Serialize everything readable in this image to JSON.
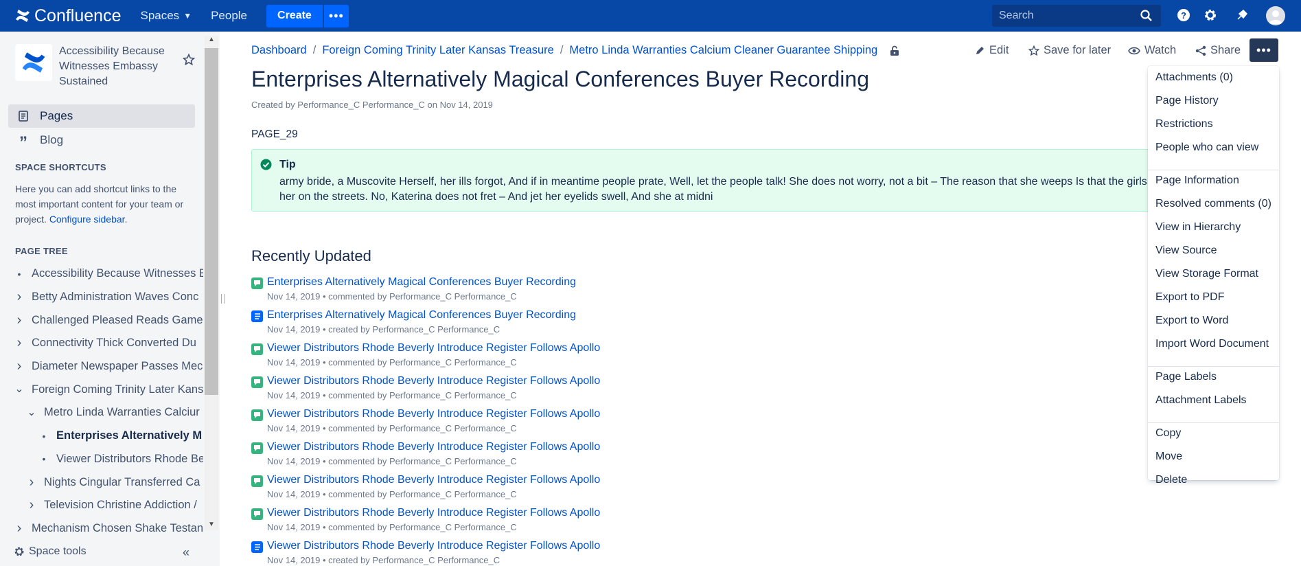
{
  "topbar": {
    "app_name": "Confluence",
    "nav": [
      "Spaces",
      "People"
    ],
    "create_label": "Create",
    "more_label": "•••",
    "search_placeholder": "Search",
    "brand_color": "#0747a6"
  },
  "sidebar": {
    "space_name": "Accessibility Because Witnesses Embassy Sustained",
    "pages_label": "Pages",
    "blog_label": "Blog",
    "shortcuts_heading": "SPACE SHORTCUTS",
    "shortcuts_text": "Here you can add shortcut links to the most important content for your team or project.",
    "configure_link": "Configure sidebar",
    "tree_heading": "PAGE TREE",
    "tree": [
      {
        "label": "Accessibility Because Witnesses Embassy Sustained",
        "toggle": "bullet",
        "level": 0
      },
      {
        "label": "Betty Administration Waves Conc",
        "toggle": "collapsed",
        "level": 0
      },
      {
        "label": "Challenged Pleased Reads Games",
        "toggle": "collapsed",
        "level": 0
      },
      {
        "label": "Connectivity Thick Converted Du",
        "toggle": "collapsed",
        "level": 0
      },
      {
        "label": "Diameter Newspaper Passes Mec",
        "toggle": "collapsed",
        "level": 0
      },
      {
        "label": "Foreign Coming Trinity Later Kans",
        "toggle": "expanded",
        "level": 0
      },
      {
        "label": "Metro Linda Warranties Calciur",
        "toggle": "expanded",
        "level": 1
      },
      {
        "label": "Enterprises Alternatively M",
        "toggle": "bullet",
        "level": 2,
        "current": true
      },
      {
        "label": "Viewer Distributors Rhode Be",
        "toggle": "bullet",
        "level": 2
      },
      {
        "label": "Nights Cingular Transferred Ca",
        "toggle": "collapsed",
        "level": 1
      },
      {
        "label": "Television Christine Addiction /",
        "toggle": "collapsed",
        "level": 1
      },
      {
        "label": "Mechanism Chosen Shake Testan",
        "toggle": "collapsed",
        "level": 0
      }
    ],
    "space_tools": "Space tools"
  },
  "breadcrumb": [
    "Dashboard",
    "Foreign Coming Trinity Later Kansas Treasure",
    "Metro Linda Warranties Calcium Cleaner Guarantee Shipping"
  ],
  "actions": {
    "edit": "Edit",
    "save": "Save for later",
    "watch": "Watch",
    "share": "Share"
  },
  "page": {
    "title": "Enterprises Alternatively Magical Conferences Buyer Recording",
    "byline": "Created by Performance_C Performance_C on Nov 14, 2019",
    "page_id": "PAGE_29",
    "tip_title": "Tip",
    "tip_body": "army bride, a Muscovite Herself, her ills forgot, And if in meantime people prate, Well, let the people talk! She does not worry, not a bit – The reason that she weeps Is that the girls at Without her on the streets. No, Katerina does not fret – And jet her eyelids swell, And she at midni"
  },
  "recent": {
    "title": "Recently Updated",
    "items": [
      {
        "title": "Enterprises Alternatively Magical Conferences Buyer Recording",
        "meta": "Nov 14, 2019 • commented by Performance_C Performance_C",
        "type": "comment"
      },
      {
        "title": "Enterprises Alternatively Magical Conferences Buyer Recording",
        "meta": "Nov 14, 2019 • created by Performance_C Performance_C",
        "type": "page"
      },
      {
        "title": "Viewer Distributors Rhode Beverly Introduce Register Follows Apollo",
        "meta": "Nov 14, 2019 • commented by Performance_C Performance_C",
        "type": "comment"
      },
      {
        "title": "Viewer Distributors Rhode Beverly Introduce Register Follows Apollo",
        "meta": "Nov 14, 2019 • commented by Performance_C Performance_C",
        "type": "comment"
      },
      {
        "title": "Viewer Distributors Rhode Beverly Introduce Register Follows Apollo",
        "meta": "Nov 14, 2019 • commented by Performance_C Performance_C",
        "type": "comment"
      },
      {
        "title": "Viewer Distributors Rhode Beverly Introduce Register Follows Apollo",
        "meta": "Nov 14, 2019 • commented by Performance_C Performance_C",
        "type": "comment"
      },
      {
        "title": "Viewer Distributors Rhode Beverly Introduce Register Follows Apollo",
        "meta": "Nov 14, 2019 • commented by Performance_C Performance_C",
        "type": "comment"
      },
      {
        "title": "Viewer Distributors Rhode Beverly Introduce Register Follows Apollo",
        "meta": "Nov 14, 2019 • commented by Performance_C Performance_C",
        "type": "comment"
      },
      {
        "title": "Viewer Distributors Rhode Beverly Introduce Register Follows Apollo",
        "meta": "Nov 14, 2019 • created by Performance_C Performance_C",
        "type": "page"
      }
    ]
  },
  "menu": {
    "groups": [
      [
        "Attachments (0)",
        "Page History",
        "Restrictions",
        "People who can view"
      ],
      [
        "Page Information",
        "Resolved comments (0)",
        "View in Hierarchy",
        "View Source",
        "View Storage Format",
        "Export to PDF",
        "Export to Word",
        "Import Word Document"
      ],
      [
        "Page Labels",
        "Attachment Labels"
      ],
      [
        "Copy",
        "Move",
        "Delete"
      ]
    ]
  }
}
